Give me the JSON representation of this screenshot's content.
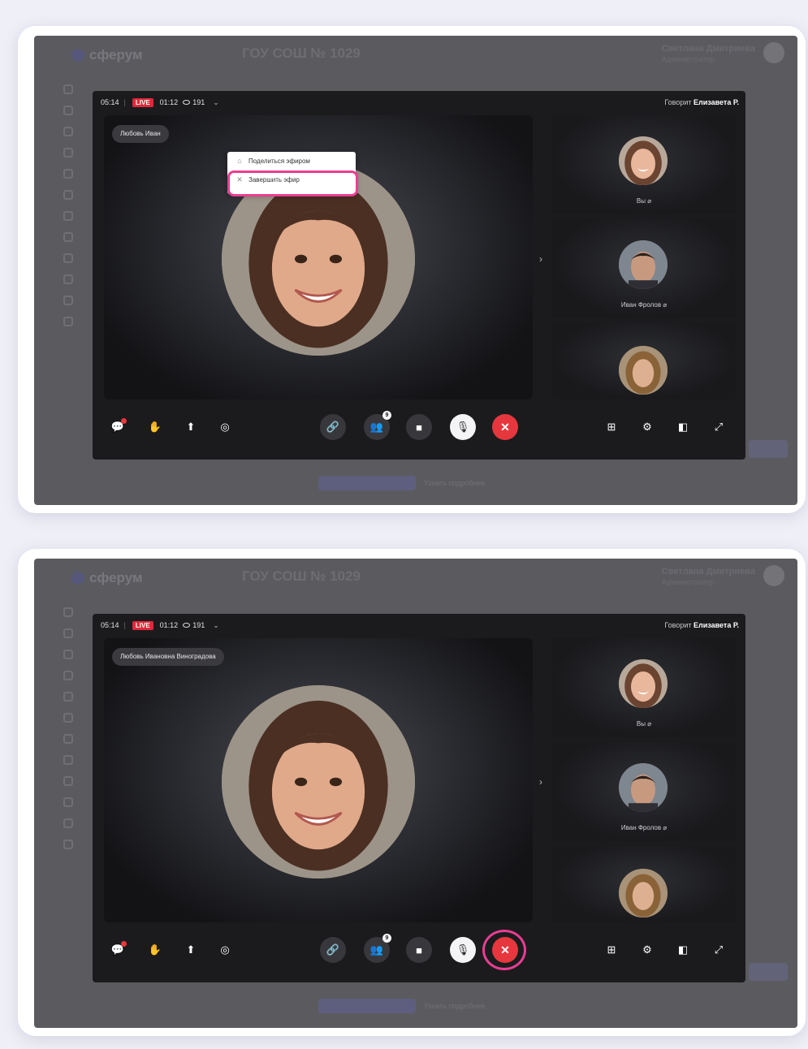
{
  "background_app": {
    "logo": "сферум",
    "school": "ГОУ СОШ № 1029",
    "user_name": "Светлана Дмитриева",
    "user_role": "Администратор",
    "link_text": "Узнать подробнее"
  },
  "call": {
    "clock": "05:14",
    "live_label": "LIVE",
    "duration": "01:12",
    "viewers": "191",
    "speaker_prefix": "Говорит",
    "speaker_name": "Елизавета Р.",
    "main_participant": "Любовь Ивановна Виноградова",
    "main_participant_short": "Любовь Иван",
    "participants": [
      {
        "label": "Вы"
      },
      {
        "label": "Иван Фролов"
      },
      {
        "label": ""
      }
    ],
    "participants_badge": "9"
  },
  "menu": {
    "items": [
      {
        "label": "Поделиться эфиром"
      },
      {
        "label": "Завершить эфир"
      }
    ]
  },
  "colors": {
    "live": "#e0283a",
    "hangup": "#e6373e",
    "highlight": "#ea3d92"
  }
}
